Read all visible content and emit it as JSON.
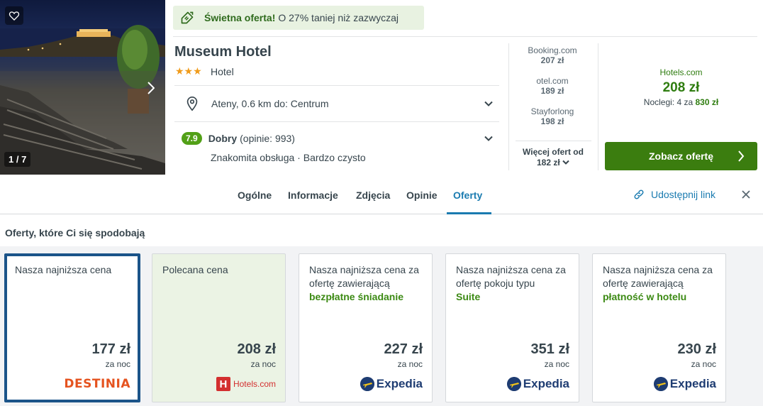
{
  "photo": {
    "counter": "1 / 7"
  },
  "deal": {
    "strong": "Świetna oferta!",
    "text": "O 27% taniej niż zazwyczaj"
  },
  "hotel": {
    "name": "Museum Hotel",
    "stars": "★★★",
    "type": "Hotel",
    "location": "Ateny, 0.6 km do: Centrum",
    "rating": "7.9",
    "rating_word": "Dobry",
    "reviews": "(opinie: 993)",
    "subratings": "Znakomita obsługa · Bardzo czysto"
  },
  "alt_offers": [
    {
      "provider": "Booking.com",
      "price": "207 zł"
    },
    {
      "provider": "otel.com",
      "price": "189 zł"
    },
    {
      "provider": "Stayforlong",
      "price": "198 zł"
    }
  ],
  "more_offers": {
    "label": "Więcej ofert od",
    "price": "182 zł"
  },
  "main_offer": {
    "provider": "Hotels.com",
    "price": "208 zł",
    "nights_prefix": "Noclegi: 4 za",
    "nights_total": "830 zł",
    "cta": "Zobacz ofertę"
  },
  "tabs": [
    {
      "label": "Ogólne"
    },
    {
      "label": "Informacje"
    },
    {
      "label": "Zdjęcia"
    },
    {
      "label": "Opinie"
    },
    {
      "label": "Oferty",
      "active": true
    }
  ],
  "share_label": "Udostępnij link",
  "offers_title": "Oferty, które Ci się spodobają",
  "offer_cards": [
    {
      "desc": "Nasza najniższa cena",
      "highlight": "",
      "price": "177 zł",
      "per": "za noc",
      "logo": "Destinia"
    },
    {
      "desc": "Polecana cena",
      "highlight": "",
      "price": "208 zł",
      "per": "za noc",
      "logo": "Hotels.com"
    },
    {
      "desc": "Nasza najniższa cena za ofertę zawierającą",
      "highlight": "bezpłatne śniadanie",
      "price": "227 zł",
      "per": "za noc",
      "logo": "Expedia"
    },
    {
      "desc": "Nasza najniższa cena za ofertę pokoju typu",
      "highlight": "Suite",
      "price": "351 zł",
      "per": "za noc",
      "logo": "Expedia"
    },
    {
      "desc": "Nasza najniższa cena za ofertę zawierającą",
      "highlight": "płatność w hotelu",
      "price": "230 zł",
      "per": "za noc",
      "logo": "Expedia"
    }
  ],
  "logo_text": {
    "destinia": "DESTINIA",
    "hotels": "Hotels.com",
    "hotels_mark": "H",
    "expedia": "Expedia"
  },
  "icons": [
    "heart-icon",
    "chevron-right-icon",
    "deal-tag-icon",
    "map-pin-icon",
    "chevron-down-icon",
    "link-icon",
    "close-icon"
  ],
  "colors": {
    "accent_blue": "#1a7bb0",
    "green": "#3b7d0f",
    "rating_green": "#52a017",
    "selected_border": "#1b5489",
    "deal_bg": "#e8f2e1"
  }
}
